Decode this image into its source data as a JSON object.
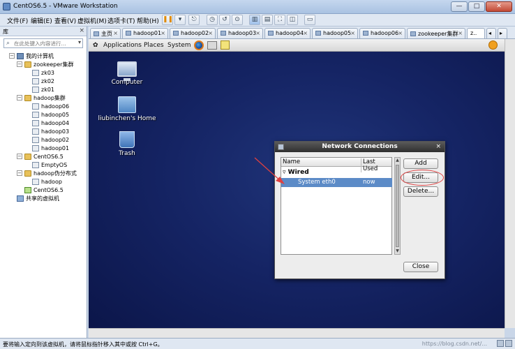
{
  "window": {
    "title": "CentOS6.5 - VMware Workstation",
    "controls": {
      "minimize": "—",
      "maximize": "□",
      "close": "✕"
    }
  },
  "menubar": {
    "items": [
      "文件(F)",
      "编辑(E)",
      "查看(V)",
      "虚拟机(M)",
      "选项卡(T)",
      "帮助(H)"
    ]
  },
  "library": {
    "title": "库",
    "close": "×",
    "search_placeholder": "在此处键入内容进行...",
    "tree": {
      "root": "我的计算机",
      "zookeeper_group": "zookeeper集群",
      "zk03": "zk03",
      "zk02": "zk02",
      "zk01": "zk01",
      "hadoop_group": "hadoop集群",
      "hadoop06": "hadoop06",
      "hadoop05": "hadoop05",
      "hadoop04": "hadoop04",
      "hadoop03": "hadoop03",
      "hadoop02": "hadoop02",
      "hadoop01": "hadoop01",
      "centos_group": "CentOS6.5",
      "emptyos": "EmptyOS",
      "hadoop_dist_group": "hadoop伪分布式",
      "hadoop": "hadoop",
      "centos65": "CentOS6.5",
      "shared": "共享的虚拟机"
    }
  },
  "tabs": [
    {
      "label": "主页"
    },
    {
      "label": "hadoop01"
    },
    {
      "label": "hadoop02"
    },
    {
      "label": "hadoop03"
    },
    {
      "label": "hadoop04"
    },
    {
      "label": "hadoop05"
    },
    {
      "label": "hadoop06"
    },
    {
      "label": "zookeeper集群"
    },
    {
      "label": "z.."
    }
  ],
  "guest": {
    "panel": {
      "applications": "Applications",
      "places": "Places",
      "system": "System"
    },
    "desktop": {
      "computer": "Computer",
      "home": "liubinchen's Home",
      "trash": "Trash"
    },
    "dialog": {
      "title": "Network Connections",
      "close": "×",
      "columns": {
        "name": "Name",
        "last_used": "Last Used"
      },
      "group": "Wired",
      "row": {
        "name": "System eth0",
        "last_used": "now"
      },
      "buttons": {
        "add": "Add",
        "edit": "Edit...",
        "delete": "Delete...",
        "close": "Close"
      }
    }
  },
  "statusbar": {
    "text": "要将输入定向到该虚拟机，请将鼠标指针移入其中或按 Ctrl+G。",
    "watermark": "https://blog.csdn.net/..."
  },
  "colors": {
    "desktop": "#152464",
    "selection": "#5c8bc7",
    "annotation": "#e04040"
  }
}
